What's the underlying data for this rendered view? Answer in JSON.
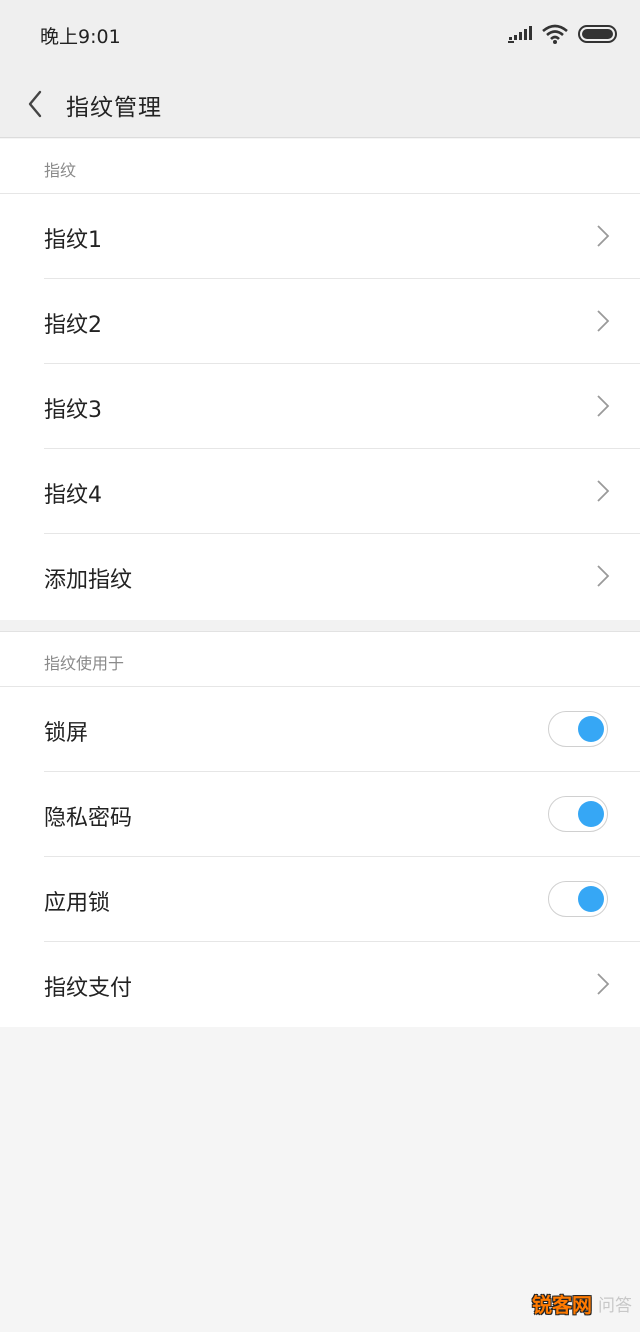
{
  "status_bar": {
    "time": "晚上9:01",
    "icons": [
      "signal-icon",
      "wifi-icon",
      "battery-icon"
    ]
  },
  "header": {
    "back_icon": "chevron-left-icon",
    "title": "指纹管理"
  },
  "fingerprints_section": {
    "header": "指纹",
    "items": [
      {
        "label": "指纹1"
      },
      {
        "label": "指纹2"
      },
      {
        "label": "指纹3"
      },
      {
        "label": "指纹4"
      },
      {
        "label": "添加指纹"
      }
    ]
  },
  "usage_section": {
    "header": "指纹使用于",
    "items": [
      {
        "label": "锁屏",
        "control": "toggle",
        "on": true
      },
      {
        "label": "隐私密码",
        "control": "toggle",
        "on": true
      },
      {
        "label": "应用锁",
        "control": "toggle",
        "on": true
      },
      {
        "label": "指纹支付",
        "control": "chevron"
      }
    ]
  },
  "colors": {
    "accent": "#36a7f5",
    "background": "#f5f5f5",
    "header_bg": "#efefef"
  },
  "watermark": {
    "brand": "锐客网",
    "faded": "问答"
  }
}
